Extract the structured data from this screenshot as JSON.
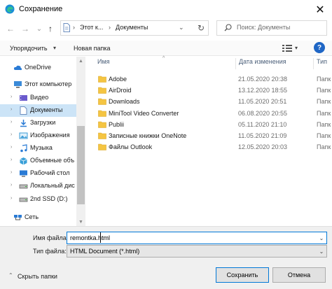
{
  "window": {
    "title": "Сохранение",
    "close_symbol": "✕"
  },
  "nav": {
    "back": "←",
    "forward": "→",
    "recent": "⌄",
    "up": "↑",
    "breadcrumb": [
      "Этот к...",
      "Документы"
    ],
    "separator": "›",
    "dropdown": "⌄",
    "refresh": "↻"
  },
  "search": {
    "placeholder": "Поиск: Документы"
  },
  "toolbar": {
    "organize_label": "Упорядочить",
    "new_folder_label": "Новая папка",
    "caret": "▾",
    "help": "?"
  },
  "sidebar": {
    "items": [
      {
        "label": "OneDrive",
        "icon": "cloud-icon",
        "caret": ""
      },
      {
        "label": "Этот компьютер",
        "icon": "computer-icon",
        "caret": ""
      },
      {
        "label": "Видео",
        "icon": "video-icon",
        "caret": "›"
      },
      {
        "label": "Документы",
        "icon": "document-icon",
        "caret": "›",
        "selected": true
      },
      {
        "label": "Загрузки",
        "icon": "download-icon",
        "caret": "›"
      },
      {
        "label": "Изображения",
        "icon": "pictures-icon",
        "caret": "›"
      },
      {
        "label": "Музыка",
        "icon": "music-icon",
        "caret": "›"
      },
      {
        "label": "Объемные объ",
        "icon": "3d-objects-icon",
        "caret": "›"
      },
      {
        "label": "Рабочий стол",
        "icon": "desktop-icon",
        "caret": "›"
      },
      {
        "label": "Локальный дис",
        "icon": "drive-icon",
        "caret": "›"
      },
      {
        "label": "2nd SSD (D:)",
        "icon": "drive-icon",
        "caret": "›"
      },
      {
        "label": "Сеть",
        "icon": "network-icon",
        "caret": "›"
      }
    ]
  },
  "filelist": {
    "columns": {
      "name": "Имя",
      "date": "Дата изменения",
      "type": "Тип"
    },
    "sort_caret": "^",
    "rows": [
      {
        "name": "Adobe",
        "date": "21.05.2020 20:38",
        "type": "Папк"
      },
      {
        "name": "AirDroid",
        "date": "13.12.2020 18:55",
        "type": "Папк"
      },
      {
        "name": "Downloads",
        "date": "11.05.2020 20:51",
        "type": "Папк"
      },
      {
        "name": "MiniTool Video Converter",
        "date": "06.08.2020 20:55",
        "type": "Папк"
      },
      {
        "name": "Publii",
        "date": "05.11.2020 21:10",
        "type": "Папк"
      },
      {
        "name": "Записные книжки OneNote",
        "date": "11.05.2020 21:09",
        "type": "Папк"
      },
      {
        "name": "Файлы Outlook",
        "date": "12.05.2020 20:03",
        "type": "Папк"
      }
    ]
  },
  "form": {
    "filename_label": "Имя файла:",
    "filename_value": "remontka.html",
    "filetype_label": "Тип файла:",
    "filetype_value": "HTML Document (*.html)",
    "hide_folders_label": "Скрыть папки",
    "save_label": "Сохранить",
    "cancel_label": "Отмена",
    "dropdown": "⌄"
  },
  "colors": {
    "accent": "#0078d7",
    "folder": "#f5c542",
    "selected": "#cce4f7"
  }
}
